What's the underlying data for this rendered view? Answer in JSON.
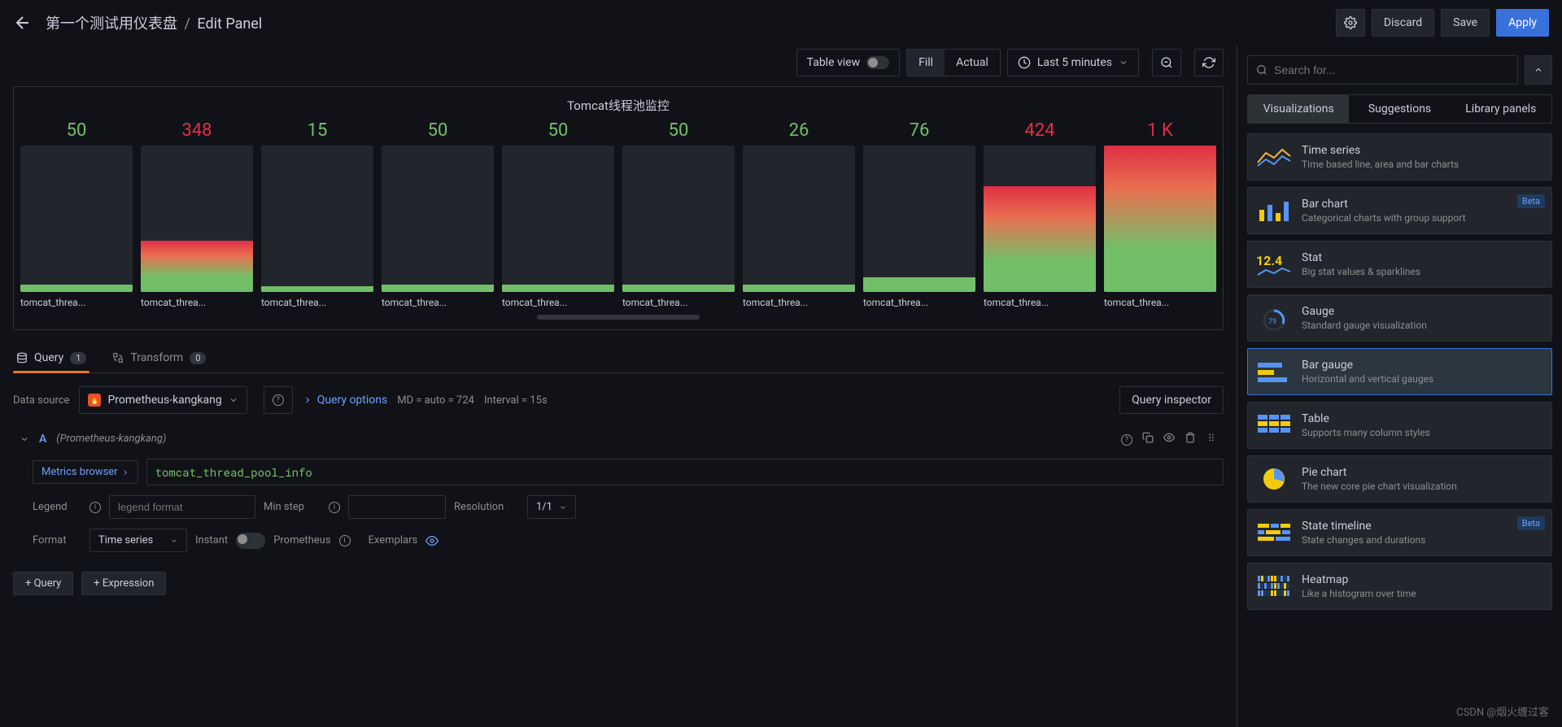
{
  "header": {
    "dashboard_name": "第一个测试用仪表盘",
    "edit_label": "Edit Panel",
    "discard": "Discard",
    "save": "Save",
    "apply": "Apply"
  },
  "toolbar": {
    "table_view": "Table view",
    "fill": "Fill",
    "actual": "Actual",
    "time_range": "Last 5 minutes"
  },
  "chart_data": {
    "type": "bar",
    "title": "Tomcat线程池监控",
    "categories": [
      "tomcat_threa...",
      "tomcat_threa...",
      "tomcat_threa...",
      "tomcat_threa...",
      "tomcat_threa...",
      "tomcat_threa...",
      "tomcat_threa...",
      "tomcat_threa...",
      "tomcat_threa...",
      "tomcat_threa..."
    ],
    "display_values": [
      "50",
      "348",
      "15",
      "50",
      "50",
      "50",
      "26",
      "76",
      "424",
      "1 K"
    ],
    "values": [
      50,
      348,
      15,
      50,
      50,
      50,
      26,
      76,
      424,
      1000
    ],
    "value_color": [
      "green",
      "red",
      "green",
      "green",
      "green",
      "green",
      "green",
      "green",
      "red",
      "red"
    ],
    "fill_pct": [
      5,
      35,
      4,
      5,
      5,
      5,
      5,
      10,
      72,
      100
    ],
    "fill_style": [
      "low",
      "grad",
      "low",
      "low",
      "low",
      "low",
      "low",
      "low",
      "grad",
      "grad"
    ],
    "ylim": [
      0,
      1000
    ]
  },
  "tabs": {
    "query": "Query",
    "query_count": "1",
    "transform": "Transform",
    "transform_count": "0"
  },
  "datasource": {
    "label": "Data source",
    "name": "Prometheus-kangkang",
    "query_options": "Query options",
    "md_hint": "MD = auto = 724",
    "interval_hint": "Interval = 15s",
    "inspector": "Query inspector"
  },
  "editor": {
    "letter": "A",
    "title": "(Prometheus-kangkang)",
    "metrics_browser": "Metrics browser",
    "metric_expr": "tomcat_thread_pool_info",
    "legend_label": "Legend",
    "legend_placeholder": "legend format",
    "minstep_label": "Min step",
    "resolution_label": "Resolution",
    "resolution_value": "1/1",
    "format_label": "Format",
    "format_value": "Time series",
    "instant_label": "Instant",
    "prometheus_label": "Prometheus",
    "exemplars_label": "Exemplars",
    "add_query": "+   Query",
    "add_expression": "+   Expression"
  },
  "sidebar": {
    "search_placeholder": "Search for...",
    "tab_viz": "Visualizations",
    "tab_sugg": "Suggestions",
    "tab_lib": "Library panels",
    "items": [
      {
        "name": "Time series",
        "desc": "Time based line, area and bar charts",
        "beta": false
      },
      {
        "name": "Bar chart",
        "desc": "Categorical charts with group support",
        "beta": true
      },
      {
        "name": "Stat",
        "desc": "Big stat values & sparklines",
        "beta": false
      },
      {
        "name": "Gauge",
        "desc": "Standard gauge visualization",
        "beta": false
      },
      {
        "name": "Bar gauge",
        "desc": "Horizontal and vertical gauges",
        "beta": false
      },
      {
        "name": "Table",
        "desc": "Supports many column styles",
        "beta": false
      },
      {
        "name": "Pie chart",
        "desc": "The new core pie chart visualization",
        "beta": false
      },
      {
        "name": "State timeline",
        "desc": "State changes and durations",
        "beta": true
      },
      {
        "name": "Heatmap",
        "desc": "Like a histogram over time",
        "beta": false
      }
    ],
    "beta_label": "Beta"
  },
  "watermark": "CSDN @烟火缠过客"
}
